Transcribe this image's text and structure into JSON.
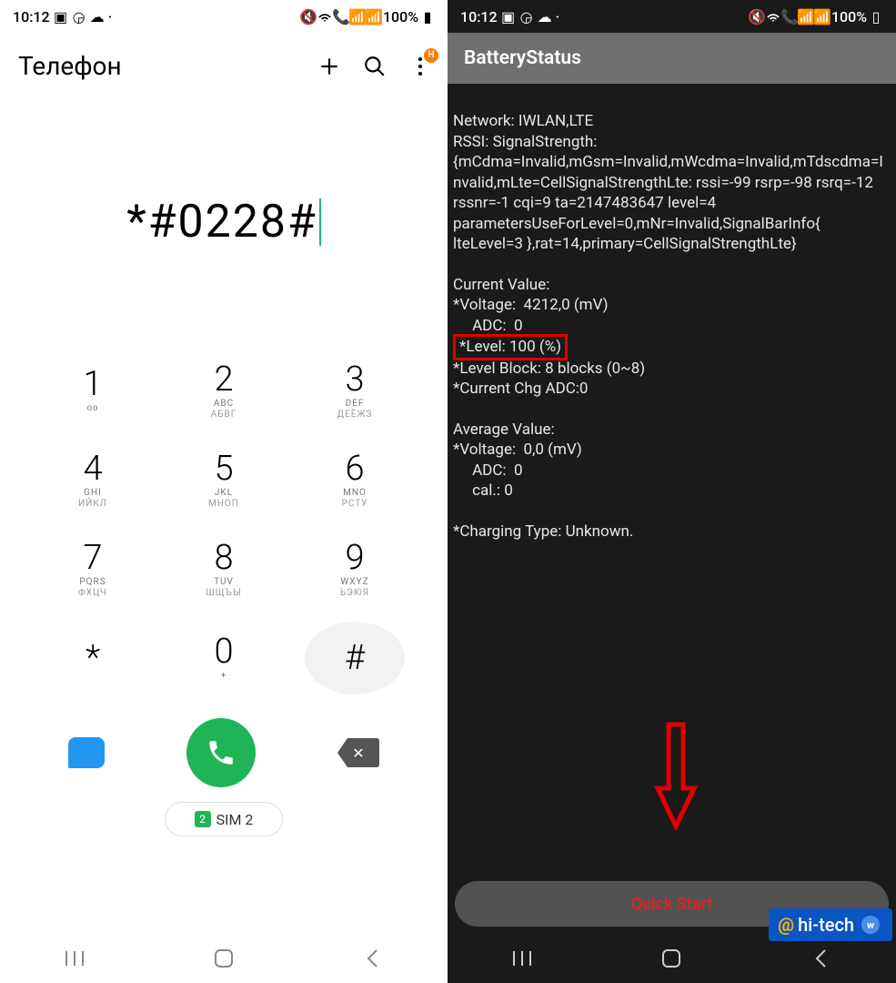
{
  "status": {
    "time": "10:12",
    "battery": "100%"
  },
  "left": {
    "title": "Телефон",
    "typed": "*#0228#",
    "menu_badge": "H",
    "keypad": [
      [
        {
          "d": "1",
          "s": "ᴏᴏ"
        },
        {
          "d": "2",
          "s": "ABC",
          "s2": "АБВГ"
        },
        {
          "d": "3",
          "s": "DEF",
          "s2": "ДЕЁЖЗ"
        }
      ],
      [
        {
          "d": "4",
          "s": "GHI",
          "s2": "ИЙКЛ"
        },
        {
          "d": "5",
          "s": "JKL",
          "s2": "МНОП"
        },
        {
          "d": "6",
          "s": "MNO",
          "s2": "РСТУ"
        }
      ],
      [
        {
          "d": "7",
          "s": "PQRS",
          "s2": "ФХЦЧ"
        },
        {
          "d": "8",
          "s": "TUV",
          "s2": "ШЩЪЫ"
        },
        {
          "d": "9",
          "s": "WXYZ",
          "s2": "ЬЭЮЯ"
        }
      ],
      [
        {
          "d": "*",
          "s": ""
        },
        {
          "d": "0",
          "s": "+"
        },
        {
          "d": "#",
          "s": "",
          "bg": true
        }
      ]
    ],
    "sim_num": "2",
    "sim_label": "SIM 2"
  },
  "right": {
    "title": "BatteryStatus",
    "network_line": "Network: IWLAN,LTE",
    "rssi_block": "RSSI: SignalStrength:{mCdma=Invalid,mGsm=Invalid,mWcdma=Invalid,mTdscdma=Invalid,mLte=CellSignalStrengthLte: rssi=-99 rsrp=-98 rsrq=-12 rssnr=-1 cqi=9 ta=2147483647 level=4 parametersUseForLevel=0,mNr=Invalid,SignalBarInfo{ lteLevel=3 },rat=14,primary=CellSignalStrengthLte}",
    "current_label": "Current Value:",
    "voltage": "*Voltage:  4212,0 (mV)",
    "adc": "     ADC:  0",
    "level": "*Level: 100 (%)",
    "level_block": "*Level Block: 8 blocks (0~8)",
    "curchg": "*Current Chg ADC:0",
    "avg_label": "Average Value:",
    "avg_voltage": "*Voltage:  0,0 (mV)",
    "avg_adc": "     ADC:  0",
    "avg_cal": "     cal.: 0",
    "charging": "*Charging Type: Unknown.",
    "button": "Quick Start"
  },
  "watermark": {
    "at": "@",
    "brand": "hi-tech"
  }
}
